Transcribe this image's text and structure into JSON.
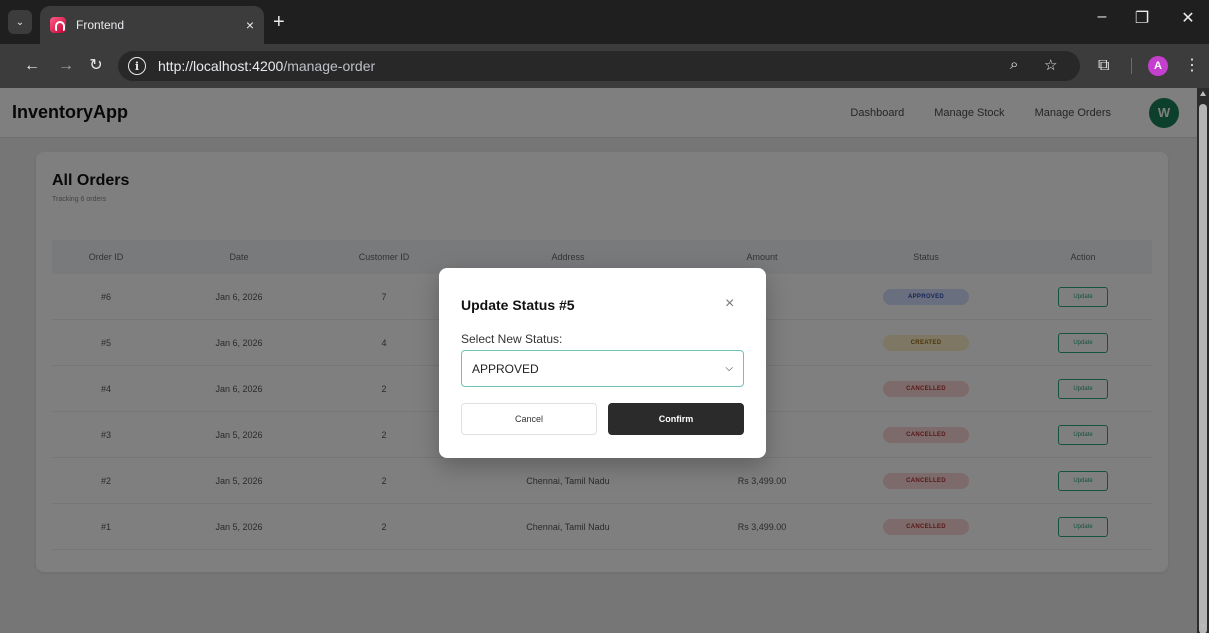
{
  "browser": {
    "tab_title": "Frontend",
    "tab_close": "×",
    "new_tab": "+",
    "url_host": "http://localhost:4200",
    "url_path": "/manage-order",
    "profile_initial": "A"
  },
  "app": {
    "brand": "InventoryApp",
    "nav": [
      "Dashboard",
      "Manage Stock",
      "Manage Orders"
    ],
    "user_initial": "W"
  },
  "orders": {
    "title": "All Orders",
    "subtitle": "Tracking 6 orders",
    "columns": [
      "Order ID",
      "Date",
      "Customer ID",
      "Address",
      "Amount",
      "Status",
      "Action"
    ],
    "rows": [
      {
        "id": "#6",
        "date": "Jan 6, 2026",
        "customer": "7",
        "address": "",
        "amount": "",
        "status": "APPROVED",
        "action": "Update"
      },
      {
        "id": "#5",
        "date": "Jan 6, 2026",
        "customer": "4",
        "address": "",
        "amount": "",
        "status": "CREATED",
        "action": "Update"
      },
      {
        "id": "#4",
        "date": "Jan 6, 2026",
        "customer": "2",
        "address": "",
        "amount": "",
        "status": "CANCELLED",
        "action": "Update"
      },
      {
        "id": "#3",
        "date": "Jan 5, 2026",
        "customer": "2",
        "address": "",
        "amount": "",
        "status": "CANCELLED",
        "action": "Update"
      },
      {
        "id": "#2",
        "date": "Jan 5, 2026",
        "customer": "2",
        "address": "Chennai, Tamil Nadu",
        "amount": "Rs 3,499.00",
        "status": "CANCELLED",
        "action": "Update"
      },
      {
        "id": "#1",
        "date": "Jan 5, 2026",
        "customer": "2",
        "address": "Chennai, Tamil Nadu",
        "amount": "Rs 3,499.00",
        "status": "CANCELLED",
        "action": "Update"
      }
    ]
  },
  "modal": {
    "title": "Update Status #5",
    "close": "×",
    "label": "Select New Status:",
    "selected": "APPROVED",
    "cancel": "Cancel",
    "confirm": "Confirm"
  },
  "colors": {
    "accent": "#2aa775",
    "avatar": "#1b7f5a",
    "confirm_bg": "#2b2b2b"
  },
  "icons": {
    "tab_search": "chevron-down-icon",
    "back": "arrow-left-icon",
    "forward": "arrow-right-icon",
    "reload": "reload-icon",
    "site_info": "info-icon",
    "zoom": "zoom-icon",
    "bookmark": "star-icon",
    "extensions": "puzzle-icon",
    "menu": "kebab-menu-icon"
  }
}
